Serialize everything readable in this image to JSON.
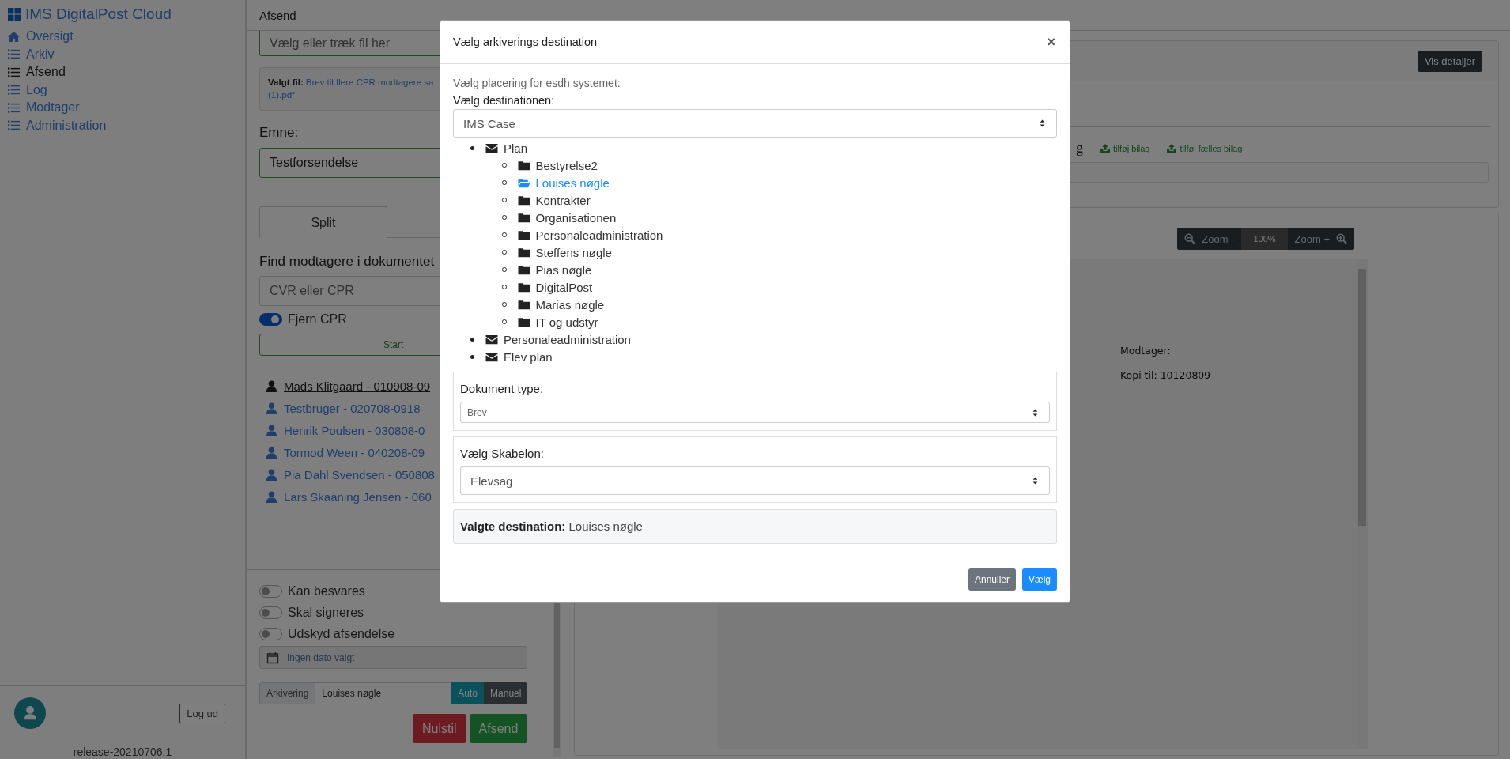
{
  "app": {
    "title": "IMS DigitalPost Cloud"
  },
  "sidebar": {
    "items": [
      {
        "label": "Oversigt",
        "selected": false
      },
      {
        "label": "Arkiv",
        "selected": false
      },
      {
        "label": "Afsend",
        "selected": true
      },
      {
        "label": "Log",
        "selected": false
      },
      {
        "label": "Modtager",
        "selected": false
      },
      {
        "label": "Administration",
        "selected": false
      }
    ],
    "logout_button": "Log ud",
    "version": "release-20210706.1"
  },
  "header": {
    "title": "Afsend"
  },
  "form": {
    "file_field": {
      "placeholder": "Vælg eller træk fil her"
    },
    "selected_file": {
      "label": "Valgt fil:",
      "name_lines": [
        "Brev til flere CPR modtagere sa",
        "(1).pdf"
      ]
    },
    "subject": {
      "label": "Emne:",
      "value": "Testforsendelse"
    },
    "tabs": [
      {
        "label": "Split",
        "selected": true
      }
    ],
    "find_heading": "Find modtagere i dokumentet",
    "cpr_field": {
      "placeholder": "CVR eller CPR"
    },
    "remove_cpr": {
      "label": "Fjern CPR",
      "on": true
    },
    "start_button": "Start",
    "recipients": [
      {
        "name": "Mads Klitgaard - 010908-09",
        "selected": true
      },
      {
        "name": "Testbruger - 020708-0918",
        "selected": false
      },
      {
        "name": "Henrik Poulsen - 030808-0",
        "selected": false
      },
      {
        "name": "Tormod Ween - 040208-09",
        "selected": false
      },
      {
        "name": "Pia Dahl Svendsen - 050808",
        "selected": false
      },
      {
        "name": "Lars Skaaning Jensen - 060",
        "selected": false
      }
    ],
    "options": [
      {
        "label": "Kan besvares",
        "on": false
      },
      {
        "label": "Skal signeres",
        "on": false
      },
      {
        "label": "Udskyd afsendelse",
        "on": false
      }
    ],
    "date_field": {
      "placeholder": "Ingen dato valgt"
    },
    "archive": {
      "label": "Arkivering",
      "value": "Louises nøgle",
      "modes": [
        {
          "label": "Auto",
          "selected": true
        },
        {
          "label": "Manuel",
          "selected": false
        }
      ]
    },
    "buttons": [
      {
        "label": "Nulstil",
        "kind": "danger"
      },
      {
        "label": "Afsend",
        "kind": "success"
      }
    ]
  },
  "details": {
    "button": "Vis detaljer",
    "heading_fragment": "g",
    "links": [
      "tilføj bilag",
      "tilføj fælles bilag"
    ]
  },
  "viewer": {
    "zoom_out": "Zoom -",
    "zoom_level": "100%",
    "zoom_in": "Zoom +",
    "document_lines": [
      "Modtager:",
      "Kopi til: 10120809"
    ]
  },
  "modal": {
    "title": "Vælg arkiverings destination",
    "close": "×",
    "intro": "Vælg placering for esdh systemet:",
    "destination_label": "Vælg destinationen:",
    "destination_value": "IMS Case",
    "tree": [
      {
        "label": "Plan",
        "kind": "mail",
        "selected": false,
        "children": [
          {
            "label": "Bestyrelse2",
            "kind": "folder",
            "selected": false
          },
          {
            "label": "Louises nøgle",
            "kind": "folder",
            "selected": true
          },
          {
            "label": "Kontrakter",
            "kind": "folder",
            "selected": false
          },
          {
            "label": "Organisationen",
            "kind": "folder",
            "selected": false
          },
          {
            "label": "Personaleadministration",
            "kind": "folder",
            "selected": false
          },
          {
            "label": "Steffens nøgle",
            "kind": "folder",
            "selected": false
          },
          {
            "label": "Pias nøgle",
            "kind": "folder",
            "selected": false
          },
          {
            "label": "DigitalPost",
            "kind": "folder",
            "selected": false
          },
          {
            "label": "Marias nøgle",
            "kind": "folder",
            "selected": false
          },
          {
            "label": "IT og udstyr",
            "kind": "folder",
            "selected": false
          }
        ]
      },
      {
        "label": "Personaleadministration",
        "kind": "mail",
        "selected": false
      },
      {
        "label": "Elev plan",
        "kind": "mail",
        "selected": false
      }
    ],
    "document_type": {
      "label": "Dokument type:",
      "value": "Brev"
    },
    "template": {
      "label": "Vælg Skabelon:",
      "value": "Elevsag"
    },
    "chosen": {
      "label": "Valgte destination:",
      "value": "Louises nøgle"
    },
    "buttons": [
      {
        "label": "Annuller",
        "kind": "secondary"
      },
      {
        "label": "Vælg",
        "kind": "primary"
      }
    ]
  }
}
